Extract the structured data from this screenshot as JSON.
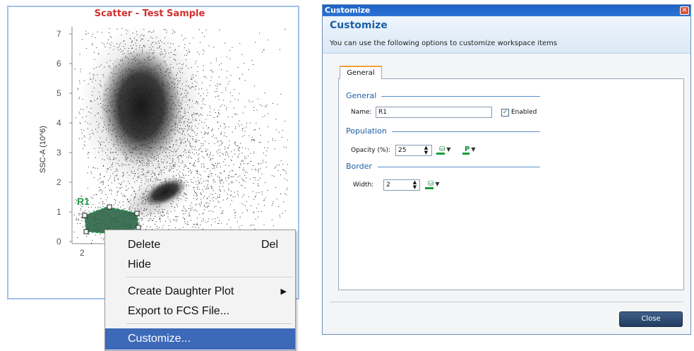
{
  "plot": {
    "title": "Scatter - Test Sample",
    "ylabel": "SSC-A (10^6)",
    "y_ticks": [
      "7",
      "6",
      "5",
      "4",
      "3",
      "2",
      "1",
      "0"
    ],
    "x_ticks": [
      "2"
    ],
    "gate_label": "R1",
    "gate_color": "#1f9a4a",
    "title_color": "#d03030"
  },
  "context_menu": {
    "items": [
      {
        "label": "Delete",
        "shortcut": "Del"
      },
      {
        "label": "Hide"
      },
      {
        "label": "Create Daughter Plot",
        "submenu": true
      },
      {
        "label": "Export to FCS File..."
      },
      {
        "label": "Customize...",
        "selected": true
      }
    ]
  },
  "dialog": {
    "window_title": "Customize",
    "header_title": "Customize",
    "header_subtitle": "You can use the following options to customize workspace items",
    "tab_label": "General",
    "sections": {
      "general": "General",
      "population": "Population",
      "border": "Border"
    },
    "fields": {
      "name_label": "Name:",
      "name_value": "R1",
      "enabled_label": "Enabled",
      "enabled_checked": true,
      "opacity_label": "Opacity (%):",
      "opacity_value": "25",
      "width_label": "Width:",
      "width_value": "2"
    },
    "close_button": "Close",
    "accent_color": "#1d5fa6"
  }
}
